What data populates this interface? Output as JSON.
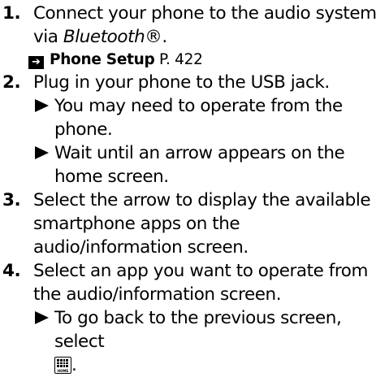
{
  "steps": [
    {
      "number": "1.",
      "text_main": "Connect your phone to the audio system via ",
      "text_italic": "Bluetooth",
      "text_reg": "®",
      "text_end": ".",
      "reference": {
        "title": "Phone Setup",
        "page": " P. 422"
      }
    },
    {
      "number": "2.",
      "text": "Plug in your phone to the USB jack.",
      "subs": [
        "You may need to operate from the phone.",
        "Wait until an arrow appears on the home screen."
      ]
    },
    {
      "number": "3.",
      "text": "Select the arrow to display the available smartphone apps on the audio/information screen."
    },
    {
      "number": "4.",
      "text": "Select an app you want to operate from the audio/information screen.",
      "sub_text": "To go back to the previous screen, select ",
      "sub_end": ".",
      "home_icon": {
        "icon": "home-grid-icon",
        "label": "HOME"
      }
    }
  ]
}
